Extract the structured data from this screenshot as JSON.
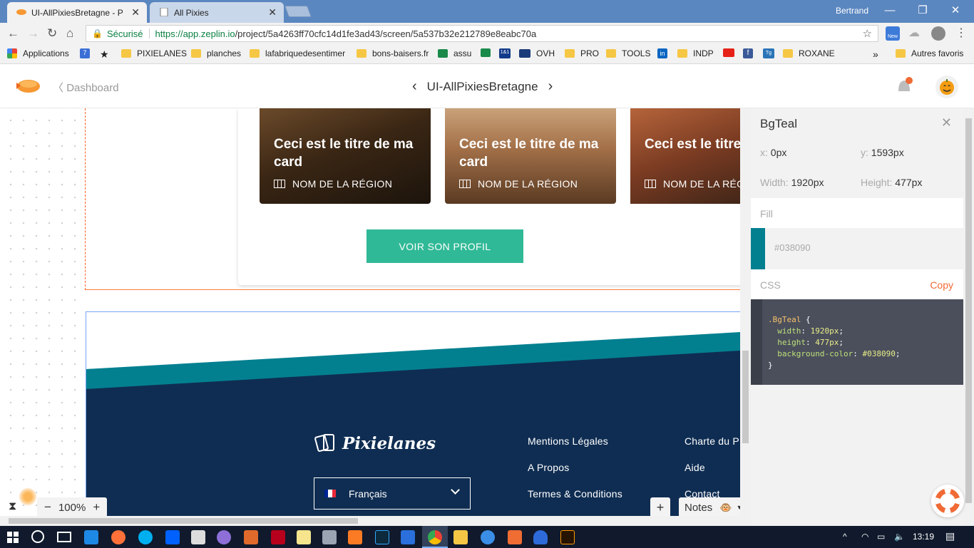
{
  "browser": {
    "tabs": [
      {
        "label": "UI-AllPixiesBretagne - Pr",
        "active": true
      },
      {
        "label": "All Pixies",
        "active": false
      }
    ],
    "user": "Bertrand",
    "window_buttons": {
      "minimize": "—",
      "restore": "❐",
      "close": "✕"
    },
    "address": {
      "secure_label": "Sécurisé",
      "url_scheme": "https://",
      "url_host": "app.zeplin.io",
      "url_path": "/project/5a4263ff70cfc14d1fe3ad43/screen/5a537b32e212789e8eabc70a"
    },
    "ext_badge": "New",
    "bookmarks": [
      {
        "label": "Applications",
        "icon": "apps-icon"
      },
      {
        "label": "",
        "icon": "calendar-icon",
        "text": "7"
      },
      {
        "label": "",
        "icon": "star-icon"
      },
      {
        "label": "PIXIELANES",
        "icon": "folder-icon"
      },
      {
        "label": "planches",
        "icon": "folder-icon"
      },
      {
        "label": "lafabriquedesentimer",
        "icon": "folder-icon"
      },
      {
        "label": "bons-baisers.fr",
        "icon": "folder-icon"
      },
      {
        "label": "assu",
        "icon": "bank-icon"
      },
      {
        "label": "",
        "icon": "bank-icon"
      },
      {
        "label": "",
        "icon": "1and1-icon",
        "text": "1&1"
      },
      {
        "label": "OVH",
        "icon": "ovh-icon"
      },
      {
        "label": "PRO",
        "icon": "folder-icon"
      },
      {
        "label": "TOOLS",
        "icon": "folder-icon"
      },
      {
        "label": "",
        "icon": "linkedin-icon",
        "text": "in"
      },
      {
        "label": "INDP",
        "icon": "folder-icon"
      },
      {
        "label": "",
        "icon": "youtube-icon"
      },
      {
        "label": "",
        "icon": "facebook-icon",
        "text": "f"
      },
      {
        "label": "",
        "icon": "tg-icon",
        "text": "Tg"
      },
      {
        "label": "ROXANE",
        "icon": "folder-icon"
      }
    ],
    "bookmarks_more": "»",
    "other_bookmarks": "Autres favoris"
  },
  "zeplin": {
    "back_label": "Dashboard",
    "project_title": "UI-AllPixiesBretagne",
    "canvas": {
      "cards": [
        {
          "title": "Ceci est le titre de ma card",
          "region": "NOM DE LA RÉGION"
        },
        {
          "title": "Ceci est le titre de ma card",
          "region": "NOM DE LA RÉGION"
        },
        {
          "title": "Ceci est le titre de ma card",
          "region": "NOM DE LA RÉGION"
        }
      ],
      "cta_label": "VOIR SON PROFIL",
      "footer": {
        "brand": "Pixielanes",
        "links_col1": [
          "Mentions Légales",
          "A Propos",
          "Termes & Conditions"
        ],
        "links_col2": [
          "Charte du P",
          "Aide",
          "Contact"
        ],
        "language": "Français"
      },
      "zoom": "100%",
      "zoom_minus": "−",
      "zoom_plus": "+",
      "add_label": "+",
      "notes_label": "Notes"
    },
    "inspector": {
      "layer_name": "BgTeal",
      "x_label": "x:",
      "x_value": "0px",
      "y_label": "y:",
      "y_value": "1593px",
      "width_label": "Width:",
      "width_value": "1920px",
      "height_label": "Height:",
      "height_value": "477px",
      "fill_label": "Fill",
      "fill_hex": "#038090",
      "css_label": "CSS",
      "copy_label": "Copy",
      "css_code": {
        "selector": ".BgTeal",
        "lines": [
          {
            "prop": "width",
            "value": "1920px"
          },
          {
            "prop": "height",
            "value": "477px"
          },
          {
            "prop": "background-color",
            "value": "#038090"
          }
        ]
      }
    }
  },
  "taskbar": {
    "time": "13:19"
  },
  "colors": {
    "teal": "#038090",
    "navy": "#0f2d52",
    "cta_green": "#30b996",
    "zeplin_orange": "#f06a35"
  }
}
